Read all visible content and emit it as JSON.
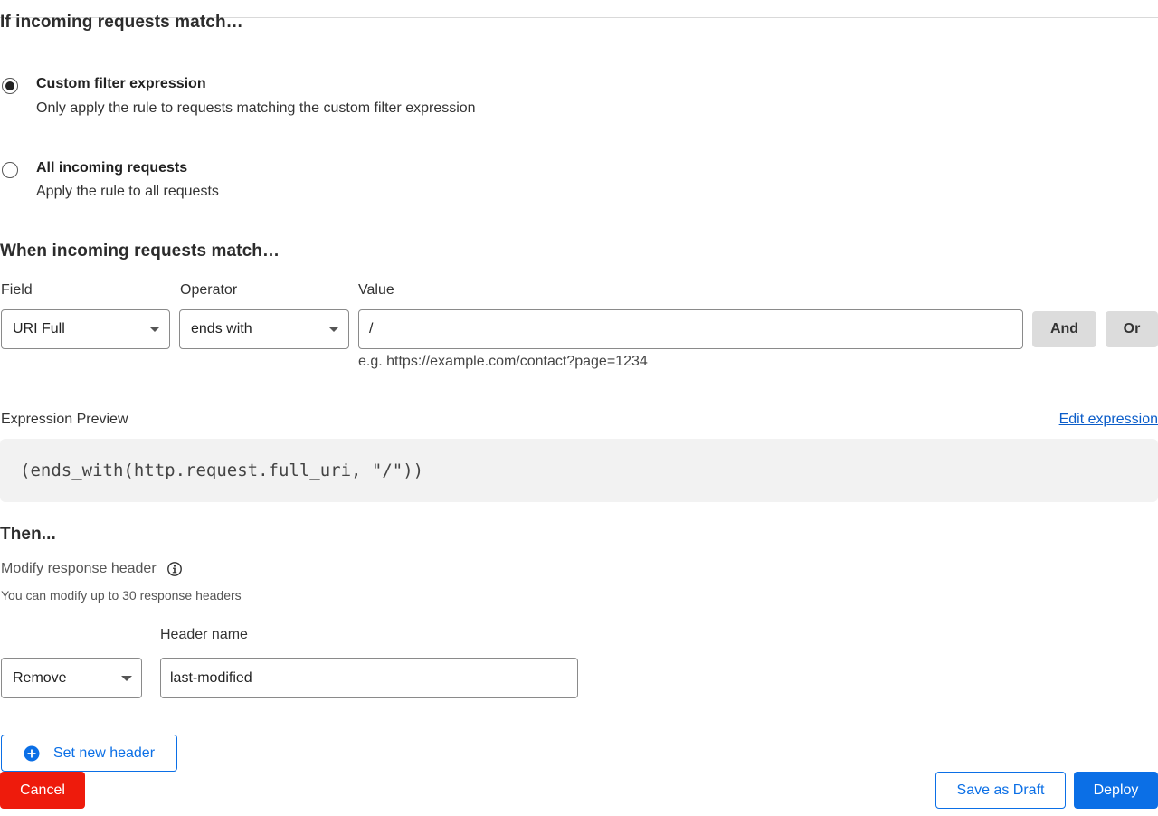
{
  "section_if": {
    "title": "If incoming requests match…"
  },
  "options": [
    {
      "title": "Custom filter expression",
      "description": "Only apply the rule to requests matching the custom filter expression",
      "checked": true
    },
    {
      "title": "All incoming requests",
      "description": "Apply the rule to all requests",
      "checked": false
    }
  ],
  "section_when": {
    "title": "When incoming requests match…"
  },
  "filter": {
    "field_label": "Field",
    "operator_label": "Operator",
    "value_label": "Value",
    "field_value": "URI Full",
    "operator_value": "ends with",
    "value_value": "/",
    "value_hint": "e.g. https://example.com/contact?page=1234",
    "and_label": "And",
    "or_label": "Or"
  },
  "preview": {
    "label": "Expression Preview",
    "edit_link": "Edit expression",
    "expression": "(ends_with(http.request.full_uri, \"/\"))"
  },
  "then": {
    "title": "Then...",
    "action_label": "Modify response header",
    "action_note": "You can modify up to 30 response headers",
    "header_name_label": "Header name",
    "operation_value": "Remove",
    "header_name_value": "last-modified",
    "set_new_header_label": "Set new header"
  },
  "footer": {
    "cancel_label": "Cancel",
    "draft_label": "Save as Draft",
    "deploy_label": "Deploy"
  },
  "colors": {
    "primary": "#0b6fe6",
    "danger": "#ee1b0c",
    "link": "#0b5dc9"
  },
  "icons": {
    "info": "info-icon",
    "plus": "plus-circle-icon",
    "caret": "chevron-down-icon"
  }
}
